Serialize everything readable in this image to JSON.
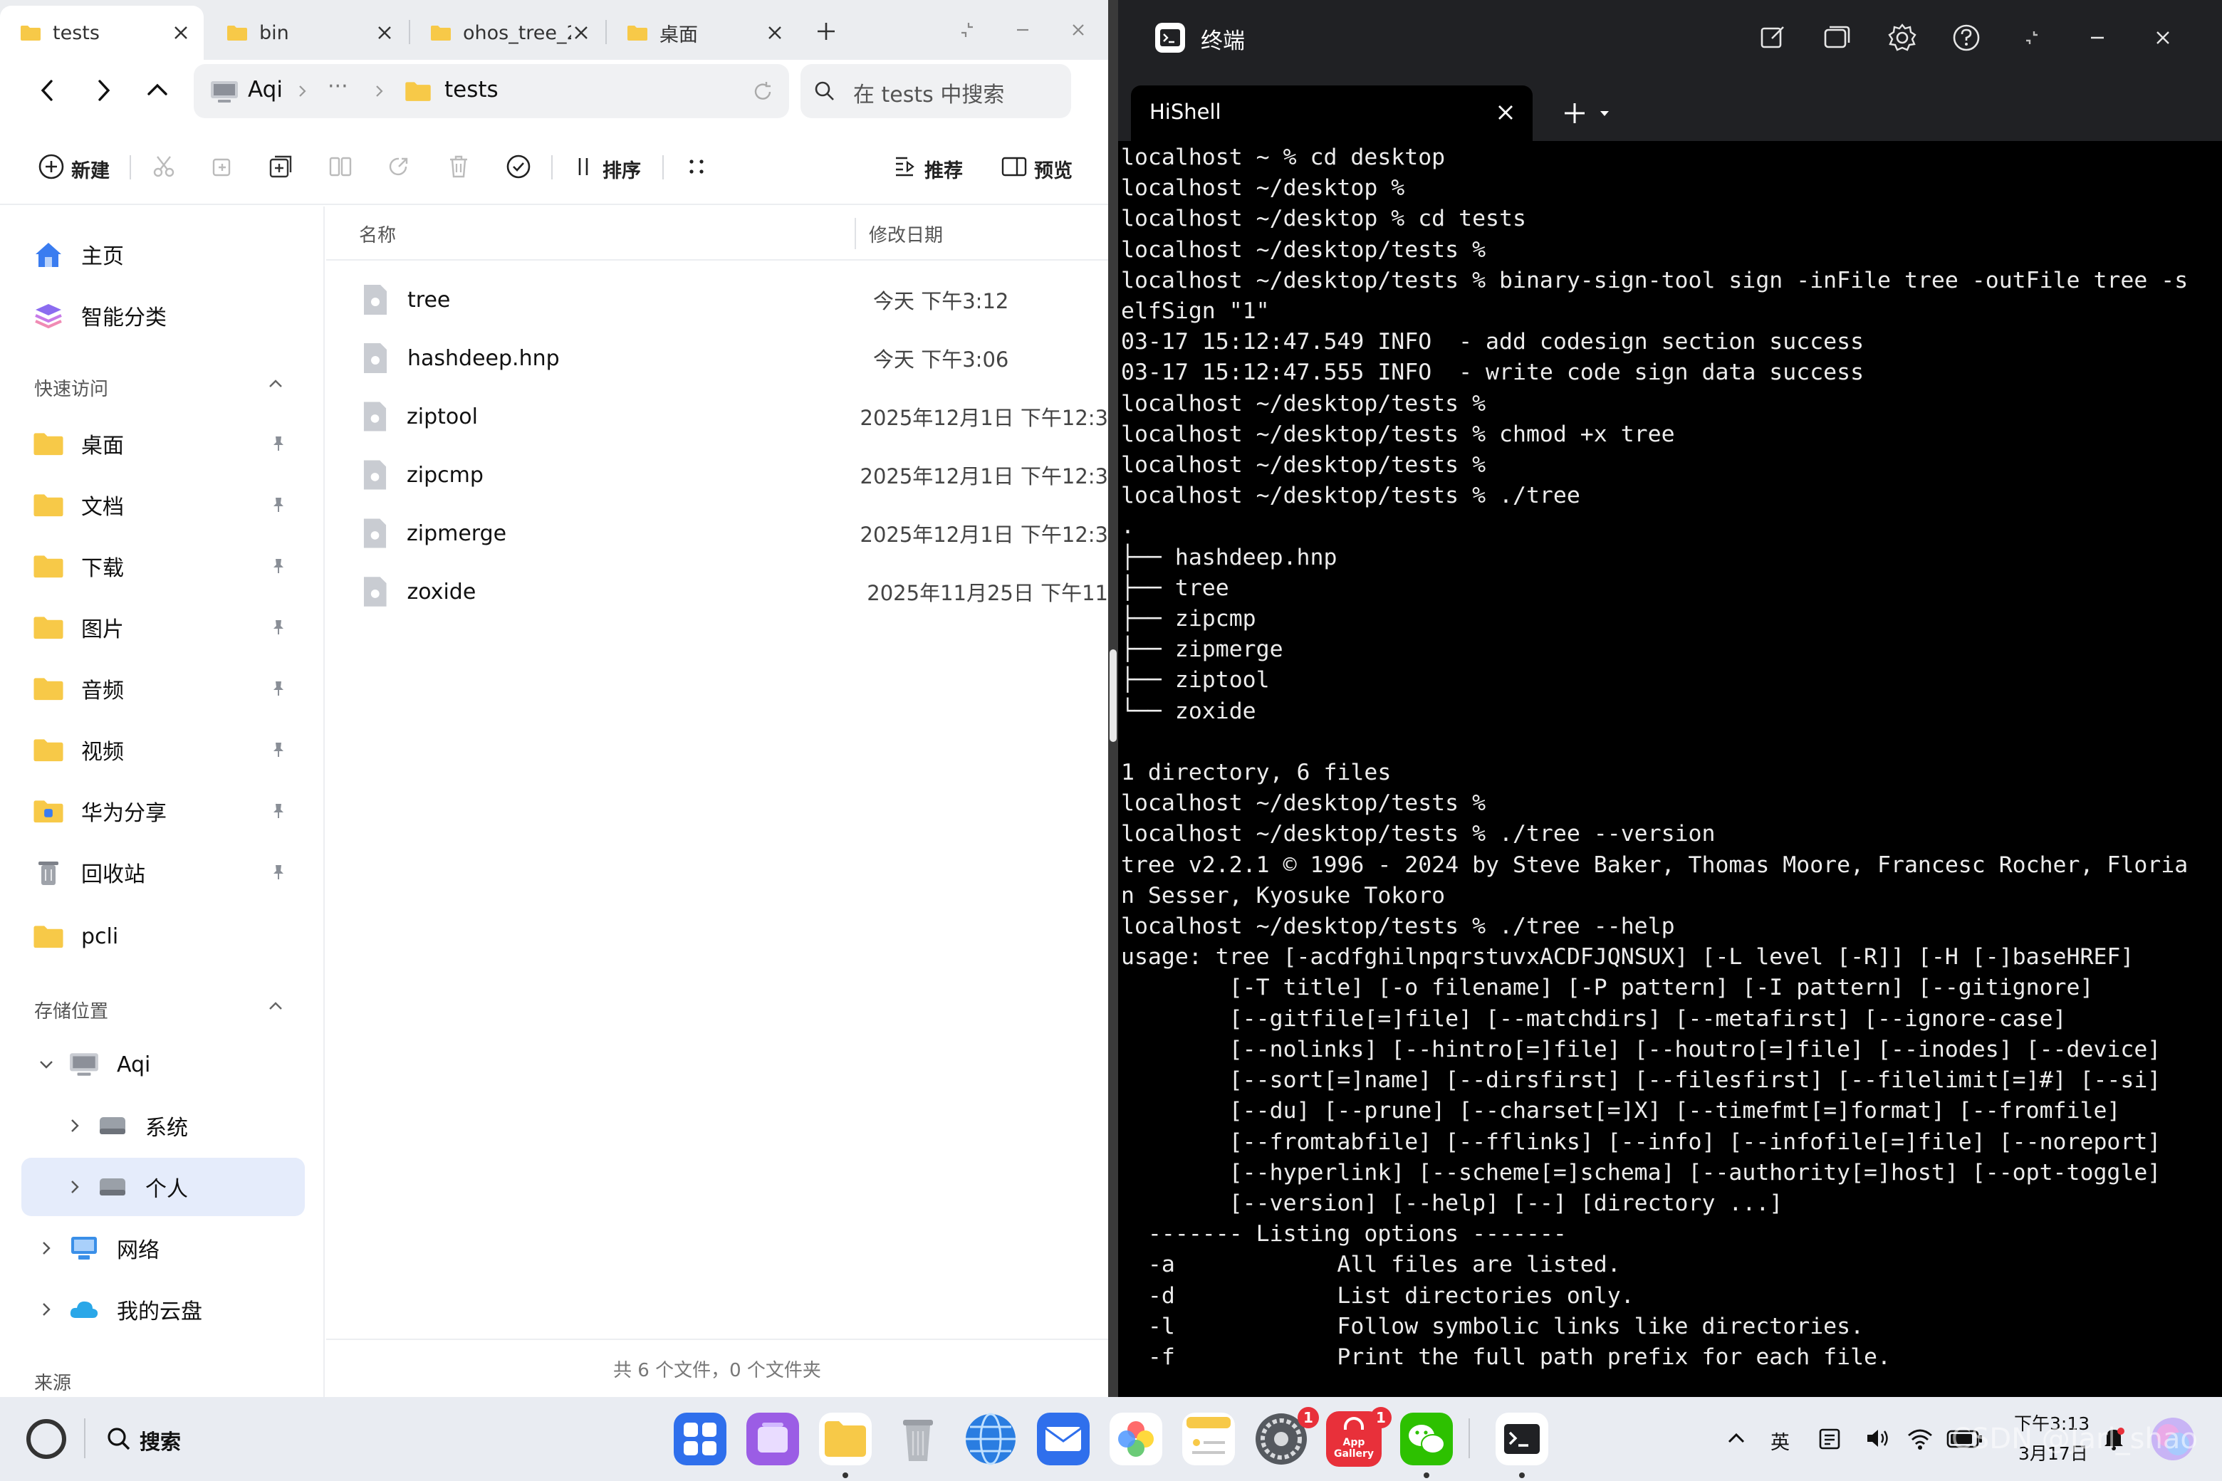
{
  "file_manager": {
    "tabs": [
      {
        "label": "tests",
        "active": true
      },
      {
        "label": "bin",
        "active": false
      },
      {
        "label": "ohos_tree_2.",
        "active": false
      },
      {
        "label": "桌面",
        "active": false
      }
    ],
    "breadcrumb": {
      "device": "Aqi",
      "ellipsis": "···",
      "folder": "tests"
    },
    "search_placeholder": "在 tests 中搜索",
    "toolbar": {
      "new_label": "新建",
      "sort_label": "排序",
      "recommend_label": "推荐",
      "preview_label": "预览"
    },
    "sidebar": {
      "top": [
        {
          "label": "主页"
        },
        {
          "label": "智能分类"
        }
      ],
      "quick_access_title": "快速访问",
      "quick_access": [
        {
          "label": "桌面"
        },
        {
          "label": "文档"
        },
        {
          "label": "下载"
        },
        {
          "label": "图片"
        },
        {
          "label": "音频"
        },
        {
          "label": "视频"
        },
        {
          "label": "华为分享"
        },
        {
          "label": "回收站"
        },
        {
          "label": "pcli"
        }
      ],
      "storage_title": "存储位置",
      "storage": {
        "device": "Aqi",
        "system": "系统",
        "personal": "个人",
        "network": "网络",
        "cloud": "我的云盘"
      },
      "next_section": "来源"
    },
    "columns": {
      "name": "名称",
      "date": "修改日期"
    },
    "files": [
      {
        "name": "tree",
        "date": "今天 下午3:12"
      },
      {
        "name": "hashdeep.hnp",
        "date": "今天 下午3:06"
      },
      {
        "name": "ziptool",
        "date": "2025年12月1日 下午12:3"
      },
      {
        "name": "zipcmp",
        "date": "2025年12月1日 下午12:3"
      },
      {
        "name": "zipmerge",
        "date": "2025年12月1日 下午12:3"
      },
      {
        "name": "zoxide",
        "date": "2025年11月25日 下午11"
      }
    ],
    "status": "共 6 个文件，0 个文件夹"
  },
  "terminal": {
    "title": "终端",
    "tab_label": "HiShell",
    "lines": [
      "localhost ~ % cd desktop",
      "localhost ~/desktop %",
      "localhost ~/desktop % cd tests",
      "localhost ~/desktop/tests %",
      "localhost ~/desktop/tests % binary-sign-tool sign -inFile tree -outFile tree -s",
      "elfSign \"1\"",
      "03-17 15:12:47.549 INFO  - add codesign section success",
      "03-17 15:12:47.555 INFO  - write code sign data success",
      "localhost ~/desktop/tests %",
      "localhost ~/desktop/tests % chmod +x tree",
      "localhost ~/desktop/tests %",
      "localhost ~/desktop/tests % ./tree",
      ".",
      "├── hashdeep.hnp",
      "├── tree",
      "├── zipcmp",
      "├── zipmerge",
      "├── ziptool",
      "└── zoxide",
      "",
      "1 directory, 6 files",
      "localhost ~/desktop/tests %",
      "localhost ~/desktop/tests % ./tree --version",
      "tree v2.2.1 © 1996 - 2024 by Steve Baker, Thomas Moore, Francesc Rocher, Floria",
      "n Sesser, Kyosuke Tokoro",
      "localhost ~/desktop/tests % ./tree --help",
      "usage: tree [-acdfghilnpqrstuvxACDFJQNSUX] [-L level [-R]] [-H [-]baseHREF]",
      "        [-T title] [-o filename] [-P pattern] [-I pattern] [--gitignore]",
      "        [--gitfile[=]file] [--matchdirs] [--metafirst] [--ignore-case]",
      "        [--nolinks] [--hintro[=]file] [--houtro[=]file] [--inodes] [--device]",
      "        [--sort[=]name] [--dirsfirst] [--filesfirst] [--filelimit[=]#] [--si]",
      "        [--du] [--prune] [--charset[=]X] [--timefmt[=]format] [--fromfile]",
      "        [--fromtabfile] [--fflinks] [--info] [--infofile[=]file] [--noreport]",
      "        [--hyperlink] [--scheme[=]schema] [--authority[=]host] [--opt-toggle]",
      "        [--version] [--help] [--] [directory ...]",
      "  ------- Listing options -------",
      "  -a            All files are listed.",
      "  -d            List directories only.",
      "  -l            Follow symbolic links like directories.",
      "  -f            Print the full path prefix for each file."
    ]
  },
  "taskbar": {
    "search_label": "搜索",
    "settings_badge": "1",
    "appgallery_badge": "1",
    "appgallery_text": "App Gallery",
    "ime_label": "英",
    "time": "下午3:13",
    "date": "3月17日",
    "watermark": "CSDN @Jarl_shao"
  },
  "colors": {
    "accent": "#2f6fec",
    "folder_yellow": "#f7c948",
    "terminal_bg": "#000000",
    "taskbar_bg": "#e9ecf2",
    "badge_red": "#e8303a"
  }
}
